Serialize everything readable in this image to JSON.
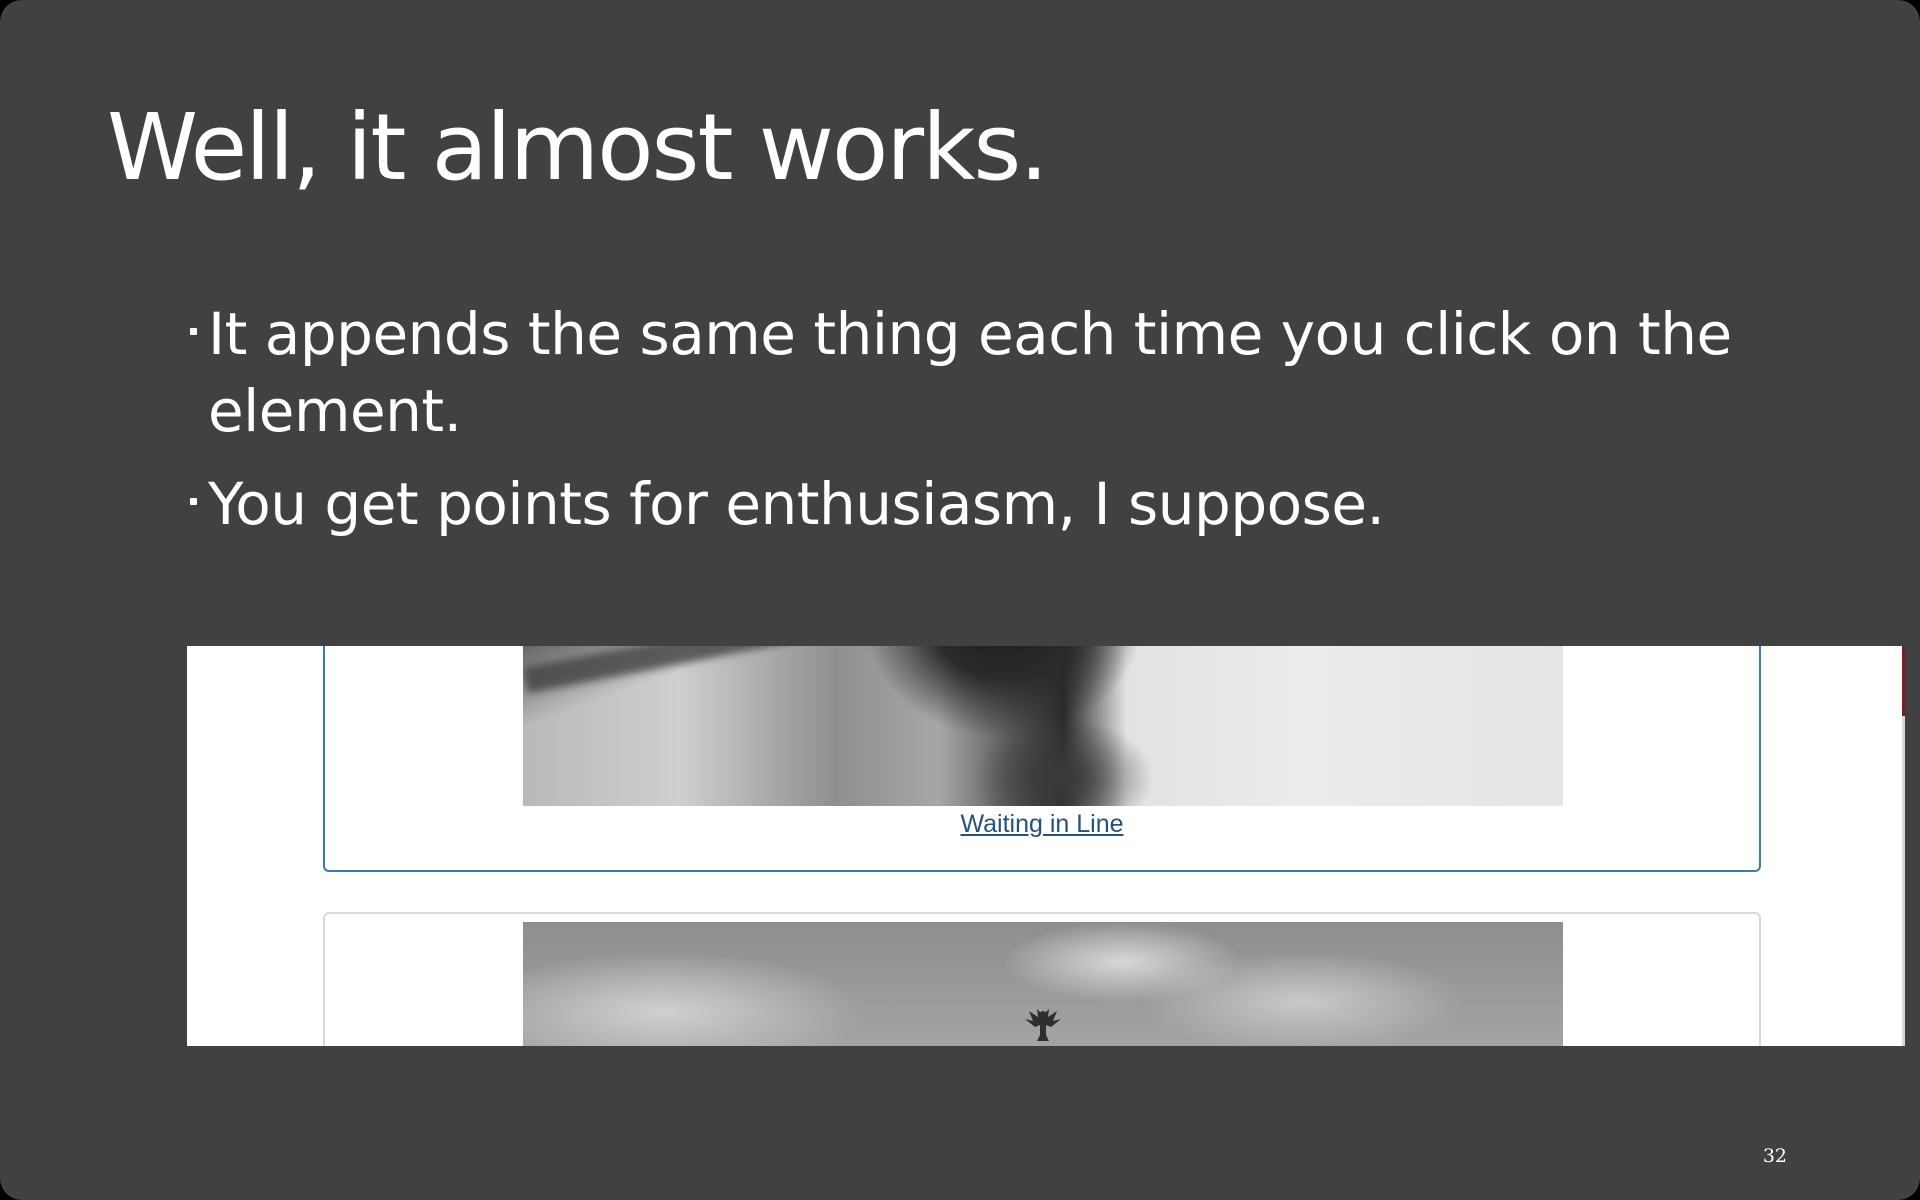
{
  "slide": {
    "title": "Well, it almost works.",
    "bullets": [
      {
        "text": "It appends the same thing each time you click on the element."
      },
      {
        "text": "You get points for enthusiasm, I suppose."
      }
    ],
    "page_number": "32"
  },
  "screenshot": {
    "cards": [
      {
        "image": "portrait-photo",
        "caption": "Waiting in Line"
      },
      {
        "image": "sky-photo-with-eagle-statue"
      }
    ],
    "link_color": "#23527c",
    "active_card_border_color": "#3a79b3"
  },
  "colors": {
    "slide_background": "#414141",
    "text": "#ffffff"
  }
}
